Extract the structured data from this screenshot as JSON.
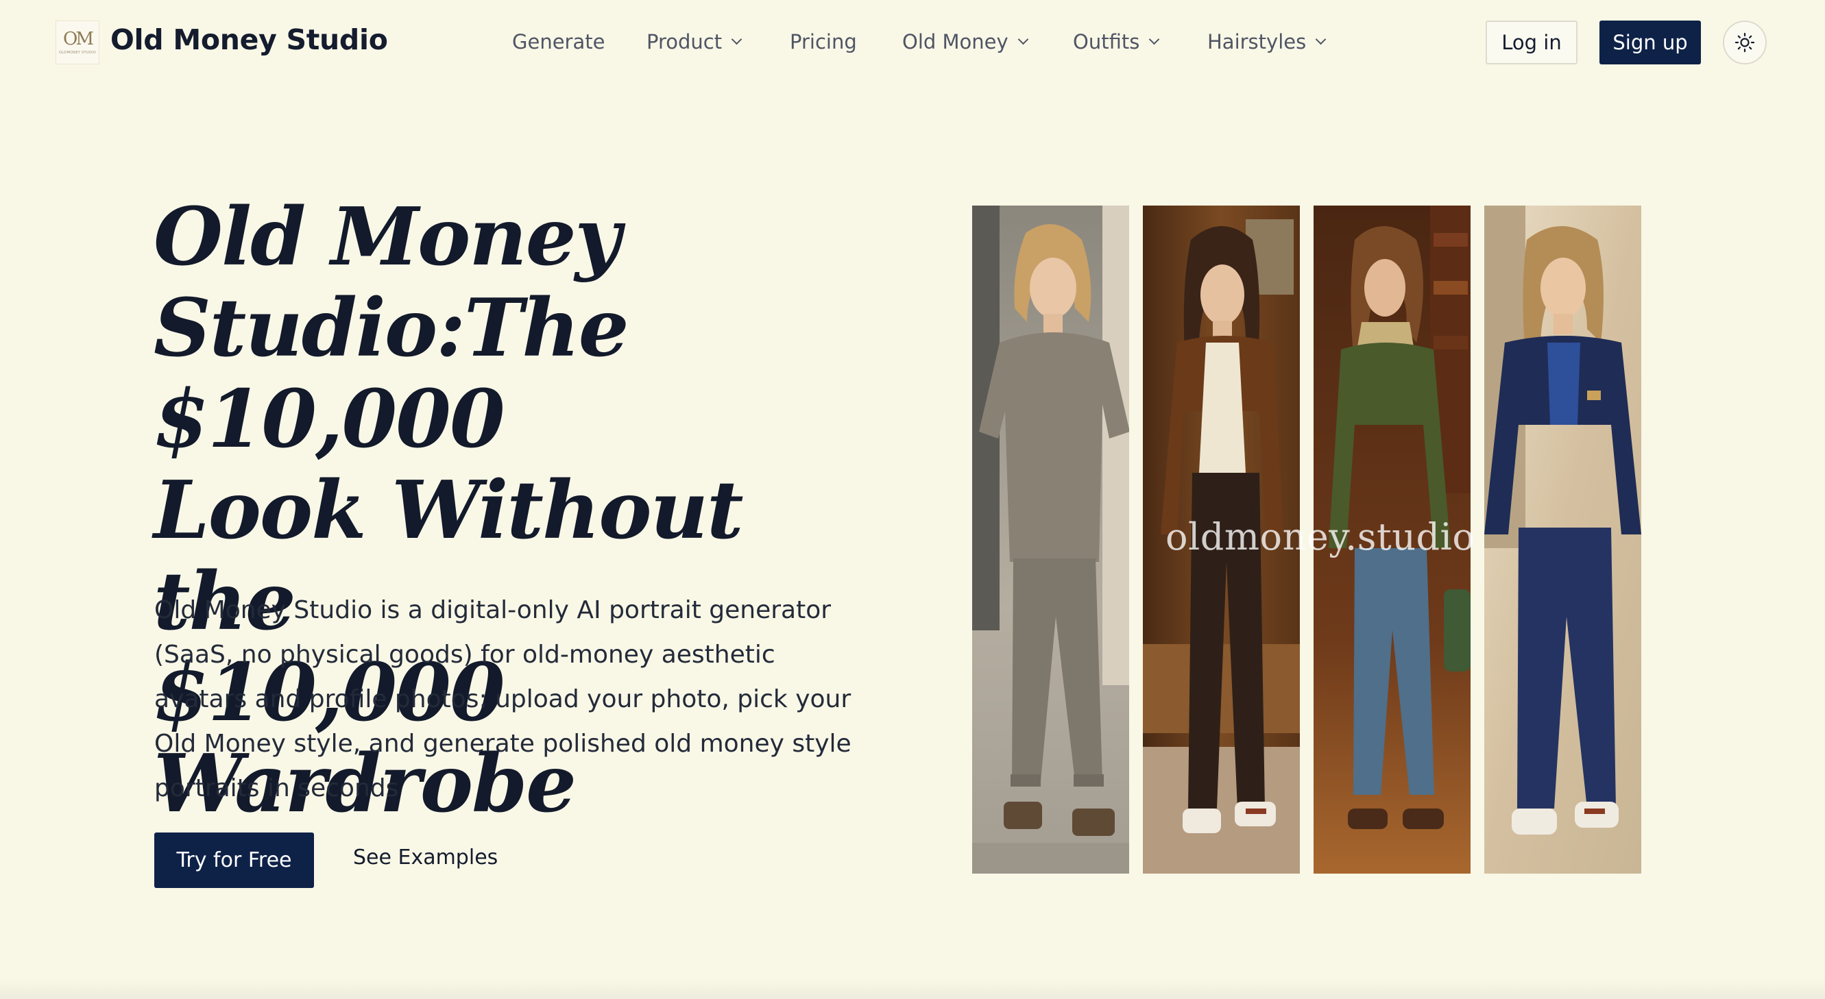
{
  "header": {
    "logo_monogram": "OM",
    "logo_subtext": "OLDMONEY STUDIO",
    "brand": "Old Money Studio",
    "nav": [
      {
        "label": "Generate",
        "dropdown": false
      },
      {
        "label": "Product",
        "dropdown": true
      },
      {
        "label": "Pricing",
        "dropdown": false
      },
      {
        "label": "Old Money",
        "dropdown": true
      },
      {
        "label": "Outfits",
        "dropdown": true
      },
      {
        "label": "Hairstyles",
        "dropdown": true
      }
    ],
    "login_label": "Log in",
    "signup_label": "Sign up",
    "theme_icon": "sun-icon"
  },
  "hero": {
    "title_lines": [
      "Old Money",
      "Studio:The $10,000",
      "Look Without the",
      "$10,000 Wardrobe"
    ],
    "description": "Old Money Studio is a digital-only AI portrait generator (SaaS, no physical goods) for old-money aesthetic avatars and profile photos: upload your photo, pick your Old Money style, and generate polished old money style portraits in seconds",
    "primary_cta": "Try for Free",
    "secondary_cta": "See Examples"
  },
  "gallery": {
    "watermark": "oldmoney.studio",
    "photos": [
      {
        "name": "casual-grey-outfit-photo",
        "icon": "woman-portrait-icon"
      },
      {
        "name": "brown-blazer-outfit-photo",
        "icon": "woman-portrait-icon"
      },
      {
        "name": "green-blazer-outfit-photo",
        "icon": "woman-portrait-icon"
      },
      {
        "name": "navy-suit-outfit-photo",
        "icon": "woman-portrait-icon"
      }
    ]
  },
  "colors": {
    "background": "#f9f7e6",
    "navy": "#0e2248",
    "text": "#141c2e",
    "nav_text": "#4f5564"
  }
}
